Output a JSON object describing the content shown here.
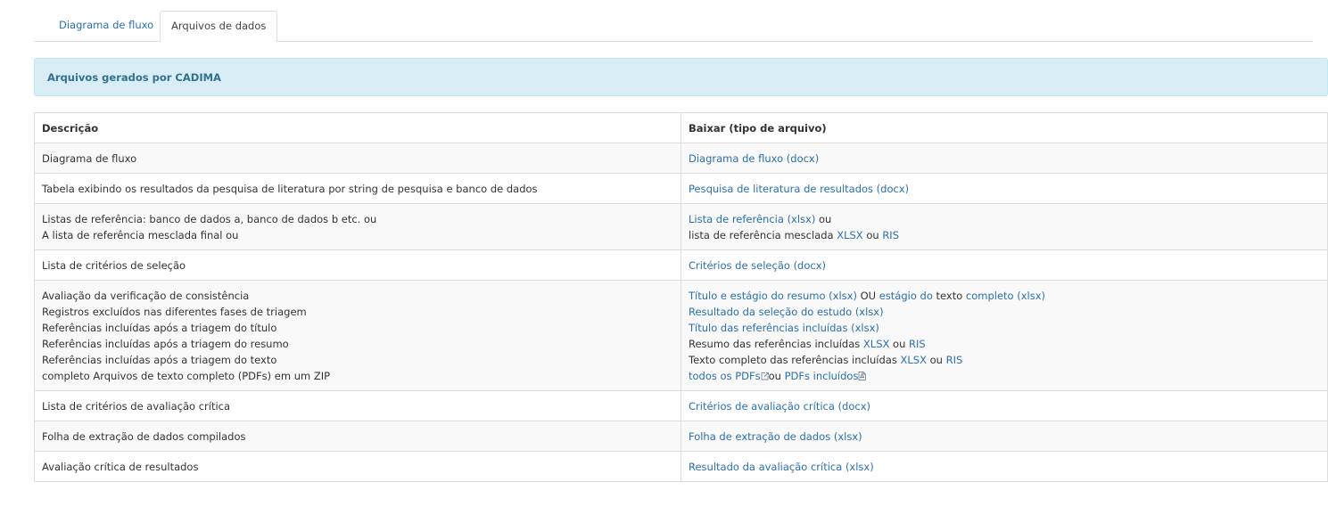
{
  "tabs": {
    "flow": "Diagrama de fluxo",
    "data": "Arquivos de dados"
  },
  "alert": "Arquivos gerados por CADIMA",
  "table": {
    "headers": {
      "desc": "Descrição",
      "download": "Baixar (tipo de arquivo)"
    },
    "rows": [
      {
        "desc": [
          "Diagrama de fluxo"
        ],
        "download": [
          [
            {
              "t": "Diagrama de fluxo (docx)",
              "link": true
            }
          ]
        ]
      },
      {
        "desc": [
          "Tabela exibindo os resultados da pesquisa de literatura por string de pesquisa e banco de dados"
        ],
        "download": [
          [
            {
              "t": "Pesquisa de literatura de resultados (docx)",
              "link": true
            }
          ]
        ]
      },
      {
        "desc": [
          "Listas de referência: banco de dados a, banco de dados b etc. ou",
          "A lista de referência mesclada final ou"
        ],
        "download": [
          [
            {
              "t": "Lista de referência (xlsx)",
              "link": true
            },
            {
              "t": " ou",
              "link": false
            }
          ],
          [
            {
              "t": "lista de referência mesclada ",
              "link": false
            },
            {
              "t": "XLSX",
              "link": true
            },
            {
              "t": " ou ",
              "link": false
            },
            {
              "t": "RIS",
              "link": true
            }
          ]
        ]
      },
      {
        "desc": [
          "Lista de critérios de seleção"
        ],
        "download": [
          [
            {
              "t": "Critérios de seleção (docx)",
              "link": true
            }
          ]
        ]
      },
      {
        "desc": [
          "Avaliação da verificação de consistência",
          "Registros excluídos nas diferentes fases de triagem",
          "Referências incluídas após a triagem do título",
          "Referências incluídas após a triagem do resumo",
          "Referências incluídas após a triagem do texto",
          "completo Arquivos de texto completo (PDFs) em um ZIP"
        ],
        "download": [
          [
            {
              "t": "Título e estágio do resumo (xlsx)",
              "link": true
            },
            {
              "t": " OU ",
              "link": false
            },
            {
              "t": "estágio do",
              "link": true
            },
            {
              "t": " texto ",
              "link": false
            },
            {
              "t": "completo (xlsx)",
              "link": true
            }
          ],
          [
            {
              "t": "Resultado da seleção do estudo (xlsx)",
              "link": true
            }
          ],
          [
            {
              "t": "Título das referências incluídas (xlsx)",
              "link": true
            }
          ],
          [
            {
              "t": "Resumo das referências incluídas ",
              "link": false
            },
            {
              "t": "XLSX",
              "link": true
            },
            {
              "t": " ou ",
              "link": false
            },
            {
              "t": "RIS",
              "link": true
            }
          ],
          [
            {
              "t": "Texto completo das referências incluídas ",
              "link": false
            },
            {
              "t": "XLSX",
              "link": true
            },
            {
              "t": " ou ",
              "link": false
            },
            {
              "t": "RIS",
              "link": true
            }
          ],
          [
            {
              "t": "todos os PDFs",
              "link": true,
              "icon": "external-file-icon"
            },
            {
              "t": "ou ",
              "link": false
            },
            {
              "t": "PDFs incluídos",
              "link": true,
              "icon": "pdf-file-icon"
            }
          ]
        ]
      },
      {
        "desc": [
          "Lista de critérios de avaliação crítica"
        ],
        "download": [
          [
            {
              "t": "Critérios de avaliação crítica (docx)",
              "link": true
            }
          ]
        ]
      },
      {
        "desc": [
          "Folha de extração de dados compilados"
        ],
        "download": [
          [
            {
              "t": "Folha de extração de dados (xlsx)",
              "link": true
            }
          ]
        ]
      },
      {
        "desc": [
          "Avaliação crítica de resultados"
        ],
        "download": [
          [
            {
              "t": "Resultado da avaliação crítica (xlsx)",
              "link": true
            }
          ]
        ]
      }
    ]
  },
  "colors": {
    "link": "#2a6fb0",
    "alert_bg": "#d9edf7",
    "alert_text": "#31708f",
    "stripe": "#f9f9f9",
    "border": "#dddddd"
  }
}
